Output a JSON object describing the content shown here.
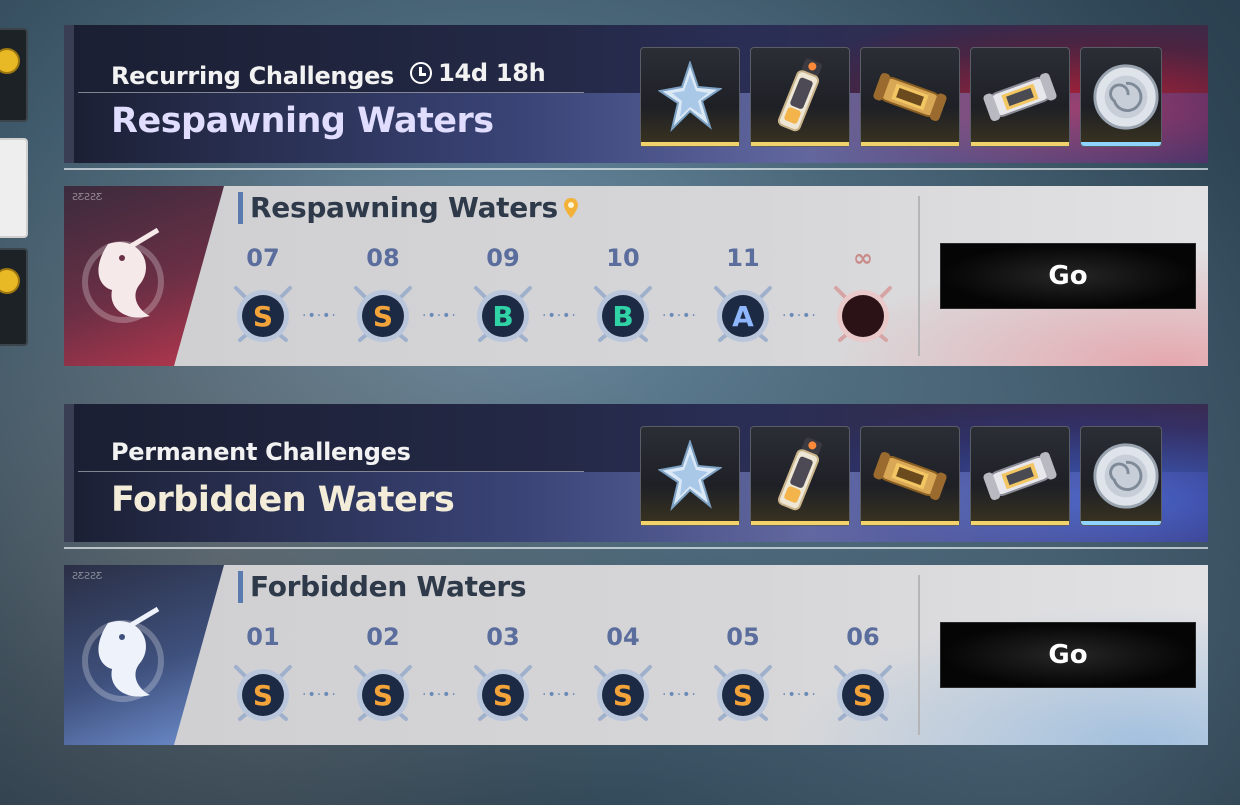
{
  "recurring": {
    "subtitle": "Recurring Challenges",
    "timer": "14d 18h",
    "title": "Respawning Waters",
    "rewards": [
      "crystal-star-icon",
      "energy-vial-icon",
      "gold-canister-icon",
      "silver-canister-icon",
      "shell-disc-icon"
    ]
  },
  "respawning_card": {
    "name": "Respawning Waters",
    "emblem_code": "ƧƸƧƧƸ",
    "stages": [
      {
        "num": "07",
        "grade": "S"
      },
      {
        "num": "08",
        "grade": "S"
      },
      {
        "num": "09",
        "grade": "B"
      },
      {
        "num": "10",
        "grade": "B"
      },
      {
        "num": "11",
        "grade": "A"
      },
      {
        "num": "∞",
        "grade": ""
      }
    ],
    "go_label": "Go"
  },
  "permanent": {
    "subtitle": "Permanent Challenges",
    "title": "Forbidden Waters",
    "rewards": [
      "crystal-star-icon",
      "energy-vial-icon",
      "gold-canister-icon",
      "silver-canister-icon",
      "shell-disc-icon"
    ]
  },
  "forbidden_card": {
    "name": "Forbidden Waters",
    "emblem_code": "ƧƸƧƧƸ",
    "stages": [
      {
        "num": "01",
        "grade": "S"
      },
      {
        "num": "02",
        "grade": "S"
      },
      {
        "num": "03",
        "grade": "S"
      },
      {
        "num": "04",
        "grade": "S"
      },
      {
        "num": "05",
        "grade": "S"
      },
      {
        "num": "06",
        "grade": "S"
      }
    ],
    "go_label": "Go"
  },
  "colors": {
    "grade_S": "#f2a33a",
    "grade_B": "#2fd3a6",
    "grade_A": "#8fb7ff",
    "reward_bar_gold": "#f2d36b",
    "reward_bar_blue": "#8fd3ff"
  }
}
